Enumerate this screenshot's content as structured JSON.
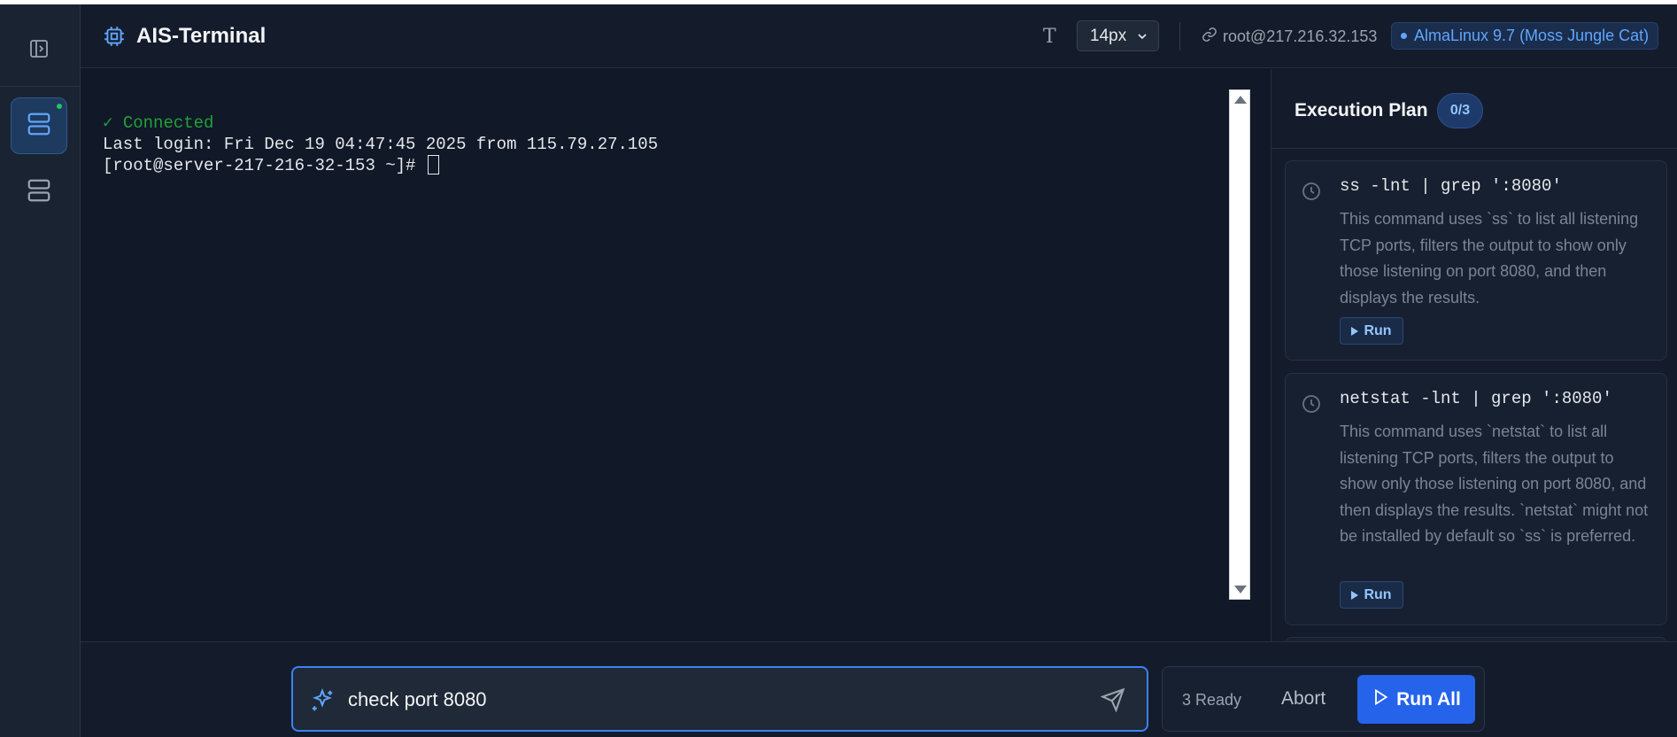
{
  "app": {
    "title": "AIS-Terminal",
    "font_size_label": "14px",
    "connection": "root@217.216.32.153",
    "os": "AlmaLinux 9.7 (Moss Jungle Cat)"
  },
  "terminal": {
    "connected": "✓ Connected",
    "last_login": "Last login: Fri Dec 19 04:47:45 2025 from 115.79.27.105",
    "prompt": "[root@server-217-216-32-153 ~]# "
  },
  "plan": {
    "title": "Execution Plan",
    "count": "0/3",
    "steps": [
      {
        "command": "ss -lnt | grep ':8080'",
        "description": "This command uses `ss` to list all listening TCP ports, filters the output to show only those listening on port 8080, and then displays the results.",
        "run_label": "Run"
      },
      {
        "command": "netstat -lnt | grep ':8080'",
        "description": "This command uses `netstat` to list all listening TCP ports, filters the output to show only those listening on port 8080, and then displays the results. `netstat` might not be installed by default so `ss` is preferred.",
        "run_label": "Run"
      }
    ]
  },
  "bottom": {
    "input_value": "check port 8080",
    "ready_text": "3 Ready",
    "abort_label": "Abort",
    "run_all_label": "Run All"
  },
  "colors": {
    "accent": "#3b82f6",
    "connected": "#22a03a",
    "online": "#22c55e"
  }
}
